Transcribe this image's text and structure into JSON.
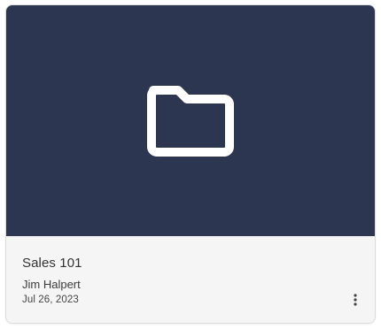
{
  "card": {
    "thumbnail": {
      "icon": "folder-icon",
      "background_color": "#2d3650",
      "icon_color": "#ffffff"
    },
    "title": "Sales 101",
    "author": "Jim Halpert",
    "date": "Jul 26, 2023",
    "menu_icon": "more-vertical-icon"
  }
}
